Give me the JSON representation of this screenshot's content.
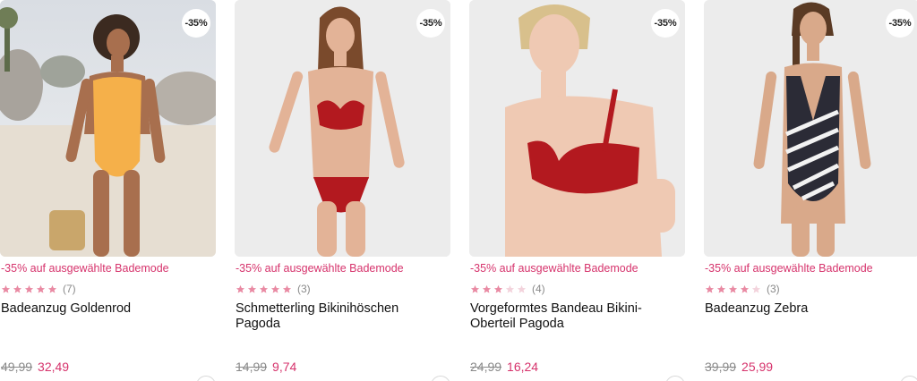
{
  "products": [
    {
      "badge": "-35%",
      "promo": "-35% auf ausgewählte Bademode",
      "rating": 5,
      "rating_count": "(7)",
      "name": "Badeanzug Goldenrod",
      "old_price": "49,99",
      "new_price": "32,49",
      "swimwear_color": "#f5b04a"
    },
    {
      "badge": "-35%",
      "promo": "-35% auf ausgewählte Bademode",
      "rating": 5,
      "rating_count": "(3)",
      "name": "Schmetterling Bikinihöschen Pagoda",
      "old_price": "14,99",
      "new_price": "9,74",
      "swimwear_color": "#b3191f"
    },
    {
      "badge": "-35%",
      "promo": "-35% auf ausgewählte Bademode",
      "rating": 3,
      "rating_count": "(4)",
      "name": "Vorgeformtes Bandeau Bikini-Oberteil Pagoda",
      "old_price": "24,99",
      "new_price": "16,24",
      "swimwear_color": "#b3191f"
    },
    {
      "badge": "-35%",
      "promo": "-35% auf ausgewählte Bademode",
      "rating": 4,
      "rating_count": "(3)",
      "name": "Badeanzug Zebra",
      "old_price": "39,99",
      "new_price": "25,99",
      "swimwear_color": "#2b2b36"
    }
  ],
  "colors": {
    "accent": "#d6336c",
    "star_filled": "#e98aa3",
    "star_empty": "#f3d3dc"
  }
}
